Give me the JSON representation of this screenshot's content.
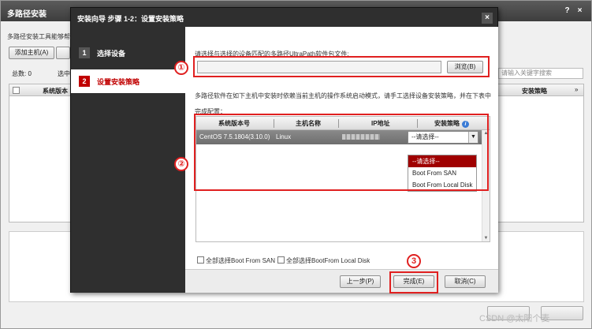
{
  "background": {
    "title": "多路径安装",
    "help_btn": "?",
    "close_btn": "×",
    "description": "多路径安装工具能够帮",
    "add_host_label": "添加主机(A)",
    "total_label": "总数: 0",
    "selected_label": "选中",
    "search_placeholder": "请输入关键字搜索",
    "col_version": "系统版本",
    "col_strategy": "安装策略",
    "col_arrow": "»",
    "btn_a": "",
    "btn_b": ""
  },
  "dialog": {
    "title": "安装向导 步骤 1-2：设置安装策略",
    "close": "×",
    "steps": [
      {
        "num": "1",
        "label": "选择设备"
      },
      {
        "num": "2",
        "label": "设置安装策略"
      }
    ],
    "prompt": "请选择与选择的设备匹配的多路径UltraPath软件包文件:",
    "file_value": "",
    "browse_label": "浏览(B)",
    "description": "多路径软件在如下主机中安装时依赖当前主机的操作系统启动模式，请手工选择设备安装策略，并在下表中完成配置：",
    "columns": {
      "version": "系统版本号",
      "host": "主机名称",
      "ip": "IP地址",
      "strategy": "安装策略"
    },
    "info_icon": "i",
    "row": {
      "version": "CentOS 7.5.1804(3.10.0)",
      "host": "Linux",
      "strategy": "--请选择--"
    },
    "dropdown": [
      "--请选择--",
      "Boot From SAN",
      "Boot From Local Disk"
    ],
    "select_all_san": "全部选择Boot From SAN",
    "select_all_local": "全部选择BootFrom Local Disk",
    "prev_label": "上一步(P)",
    "finish_label": "完成(E)",
    "cancel_label": "取消(C)"
  },
  "annotations": {
    "n1": "①",
    "n2": "②",
    "n3": "3"
  },
  "watermark": "CSDN @太阳个麦",
  "colors": {
    "accent": "#c00000",
    "annotation": "#e02020",
    "title_bar": "#3d3d3d"
  }
}
